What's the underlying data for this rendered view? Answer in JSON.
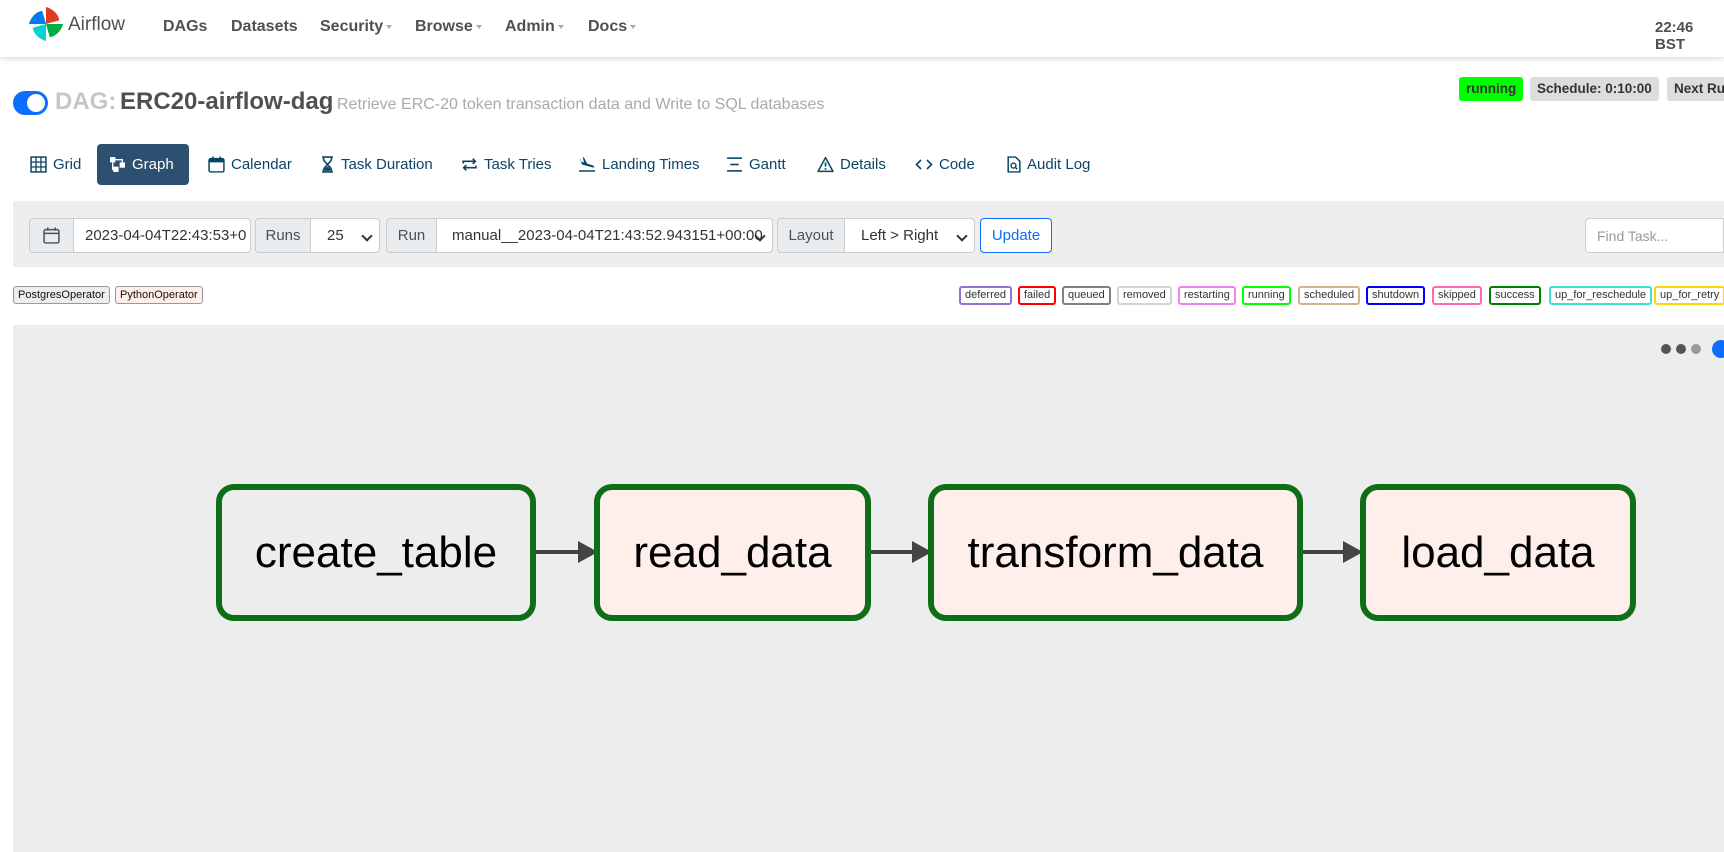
{
  "navbar": {
    "brand": "Airflow",
    "items": [
      "DAGs",
      "Datasets",
      "Security",
      "Browse",
      "Admin",
      "Docs"
    ],
    "clock": "22:46 BST"
  },
  "dag": {
    "label": "DAG:",
    "id": "ERC20-airflow-dag",
    "description": "Retrieve ERC-20 token transaction data and Write to SQL databases",
    "paused": false,
    "state": "running",
    "schedule": "Schedule: 0:10:00",
    "next_run": "Next Ru"
  },
  "tabs": [
    "Grid",
    "Graph",
    "Calendar",
    "Task Duration",
    "Task Tries",
    "Landing Times",
    "Gantt",
    "Details",
    "Code",
    "Audit Log"
  ],
  "active_tab": "Graph",
  "controls": {
    "base_date": "2023-04-04T22:43:53+0",
    "runs_label": "Runs",
    "runs_value": "25",
    "run_label": "Run",
    "run_value": "manual__2023-04-04T21:43:52.943151+00:00",
    "layout_label": "Layout",
    "layout_value": "Left > Right",
    "update_label": "Update",
    "find_placeholder": "Find Task..."
  },
  "operators": [
    {
      "name": "PostgresOperator",
      "color": "#ededed"
    },
    {
      "name": "PythonOperator",
      "color": "#ffefeb"
    }
  ],
  "states": [
    {
      "name": "deferred",
      "color": "#9370db"
    },
    {
      "name": "failed",
      "color": "#ff0000"
    },
    {
      "name": "queued",
      "color": "#808080"
    },
    {
      "name": "removed",
      "color": "#d3d3d3"
    },
    {
      "name": "restarting",
      "color": "#ee82ee"
    },
    {
      "name": "running",
      "color": "#00ff00"
    },
    {
      "name": "scheduled",
      "color": "#d2b48c"
    },
    {
      "name": "shutdown",
      "color": "#0000ff"
    },
    {
      "name": "skipped",
      "color": "#ff69b4"
    },
    {
      "name": "success",
      "color": "#008000"
    },
    {
      "name": "up_for_reschedule",
      "color": "#40e0d0"
    },
    {
      "name": "up_for_retry",
      "color": "#ffd700"
    }
  ],
  "tasks": [
    {
      "id": "create_table",
      "operator": "PostgresOperator",
      "state": "success",
      "fill": "#ededed"
    },
    {
      "id": "read_data",
      "operator": "PythonOperator",
      "state": "success",
      "fill": "#ffefeb"
    },
    {
      "id": "transform_data",
      "operator": "PythonOperator",
      "state": "success",
      "fill": "#ffefeb"
    },
    {
      "id": "load_data",
      "operator": "PythonOperator",
      "state": "success",
      "fill": "#ffefeb"
    }
  ],
  "colors": {
    "nav_text": "#51504f",
    "tab_active_bg": "#2b5070",
    "tab_text": "#0a4466",
    "success_border": "#0e6f17",
    "toggle": "#0d6efd"
  }
}
